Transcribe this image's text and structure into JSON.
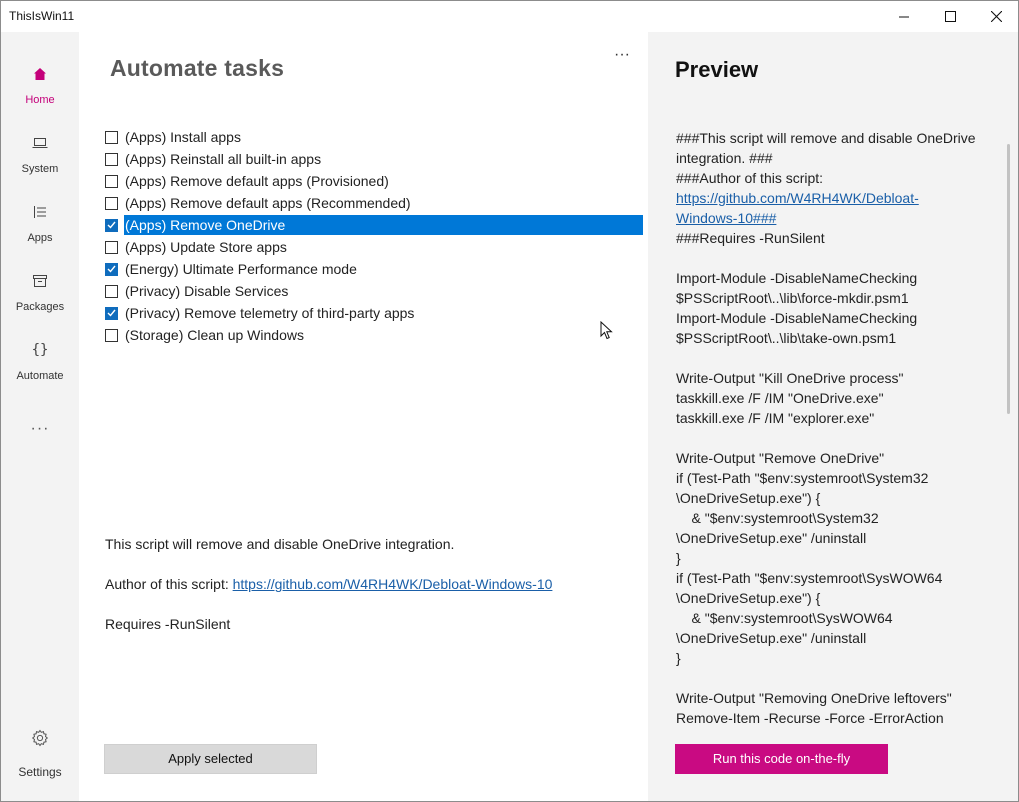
{
  "window": {
    "title": "ThisIsWin11"
  },
  "nav": {
    "items": [
      {
        "label": "Home",
        "icon": "home-icon",
        "active": true
      },
      {
        "label": "System",
        "icon": "laptop-icon"
      },
      {
        "label": "Apps",
        "icon": "list-icon"
      },
      {
        "label": "Packages",
        "icon": "package-icon"
      },
      {
        "label": "Automate",
        "icon": "braces-icon"
      }
    ],
    "more": "···",
    "settings": {
      "label": "Settings",
      "icon": "gear-icon"
    }
  },
  "main": {
    "title": "Automate tasks",
    "more": "···",
    "tasks": [
      {
        "label": "(Apps) Install apps",
        "checked": false
      },
      {
        "label": "(Apps) Reinstall all built-in apps",
        "checked": false
      },
      {
        "label": "(Apps) Remove default apps (Provisioned)",
        "checked": false
      },
      {
        "label": "(Apps) Remove default apps (Recommended)",
        "checked": false
      },
      {
        "label": "(Apps) Remove OneDrive",
        "checked": true,
        "selected": true
      },
      {
        "label": "(Apps) Update Store apps",
        "checked": false
      },
      {
        "label": "(Energy) Ultimate Performance mode",
        "checked": true
      },
      {
        "label": "(Privacy) Disable Services",
        "checked": false
      },
      {
        "label": "(Privacy) Remove telemetry of third-party apps",
        "checked": true
      },
      {
        "label": "(Storage) Clean up Windows",
        "checked": false
      }
    ],
    "description": {
      "line1": "This script will remove and disable OneDrive integration.",
      "author_prefix": "Author of this script: ",
      "author_link": "https://github.com/W4RH4WK/Debloat-Windows-10",
      "requires": "Requires -RunSilent"
    },
    "apply_button": "Apply selected"
  },
  "preview": {
    "title": "Preview",
    "code_lines": [
      {
        "text": "###This script will remove and disable OneDrive"
      },
      {
        "text": "integration. ###"
      },
      {
        "text": "###Author of this script:"
      },
      {
        "text": "https://github.com/W4RH4WK/Debloat-",
        "link": true
      },
      {
        "text": "Windows-10###",
        "link": true
      },
      {
        "text": "###Requires -RunSilent"
      },
      {
        "text": ""
      },
      {
        "text": "Import-Module -DisableNameChecking"
      },
      {
        "text": "$PSScriptRoot\\..\\lib\\force-mkdir.psm1"
      },
      {
        "text": "Import-Module -DisableNameChecking"
      },
      {
        "text": "$PSScriptRoot\\..\\lib\\take-own.psm1"
      },
      {
        "text": ""
      },
      {
        "text": "Write-Output \"Kill OneDrive process\""
      },
      {
        "text": "taskkill.exe /F /IM \"OneDrive.exe\""
      },
      {
        "text": "taskkill.exe /F /IM \"explorer.exe\""
      },
      {
        "text": ""
      },
      {
        "text": "Write-Output \"Remove OneDrive\""
      },
      {
        "text": "if (Test-Path \"$env:systemroot\\System32"
      },
      {
        "text": "\\OneDriveSetup.exe\") {"
      },
      {
        "text": "    & \"$env:systemroot\\System32"
      },
      {
        "text": "\\OneDriveSetup.exe\" /uninstall"
      },
      {
        "text": "}"
      },
      {
        "text": "if (Test-Path \"$env:systemroot\\SysWOW64"
      },
      {
        "text": "\\OneDriveSetup.exe\") {"
      },
      {
        "text": "    & \"$env:systemroot\\SysWOW64"
      },
      {
        "text": "\\OneDriveSetup.exe\" /uninstall"
      },
      {
        "text": "}"
      },
      {
        "text": ""
      },
      {
        "text": "Write-Output \"Removing OneDrive leftovers\""
      },
      {
        "text": "Remove-Item -Recurse -Force -ErrorAction"
      }
    ],
    "run_button": "Run this code on-the-fly"
  },
  "colors": {
    "accent": "#c90a82",
    "nav_active": "#c4007a",
    "selection": "#0078d7",
    "checkbox": "#0f6cbd"
  }
}
